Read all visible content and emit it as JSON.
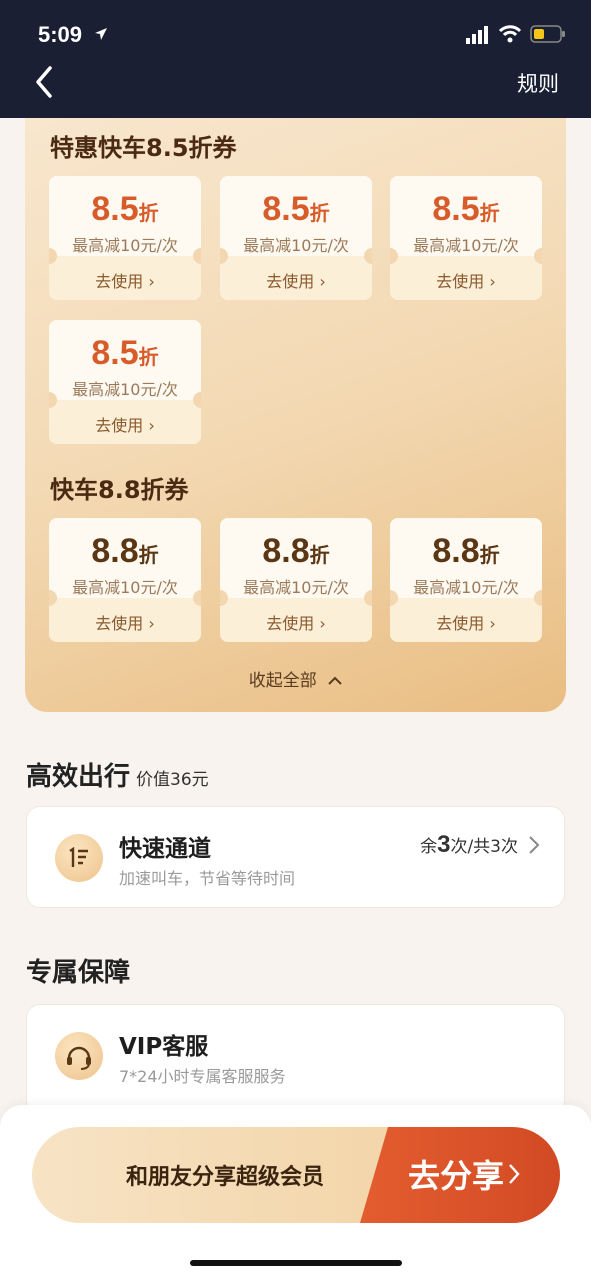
{
  "status_bar": {
    "time": "5:09"
  },
  "nav": {
    "rules_label": "规则"
  },
  "coupons": {
    "section1_title": "特惠快车8.5折券",
    "section2_title": "快车8.8折券",
    "collapse_label": "收起全部",
    "discount_unit": "折",
    "desc": "最高减10元/次",
    "use_label": "去使用",
    "values_85": [
      "8.5",
      "8.5",
      "8.5",
      "8.5"
    ],
    "values_88": [
      "8.8",
      "8.8",
      "8.8"
    ]
  },
  "efficient": {
    "title": "高效出行",
    "value_label": "价值36元",
    "card": {
      "title": "快速通道",
      "subtitle": "加速叫车，节省等待时间",
      "remaining_prefix": "余",
      "remaining_count": "3",
      "remaining_suffix": "次/共3次"
    }
  },
  "guarantee": {
    "title": "专属保障",
    "card": {
      "title": "VIP客服",
      "subtitle": "7*24小时专属客服服务"
    }
  },
  "share": {
    "left_label": "和朋友分享超级会员",
    "right_label": "去分享"
  },
  "colors": {
    "nav_bg": "#1b1f33",
    "accent_red": "#d85b2a",
    "accent_brown": "#5a3614"
  }
}
